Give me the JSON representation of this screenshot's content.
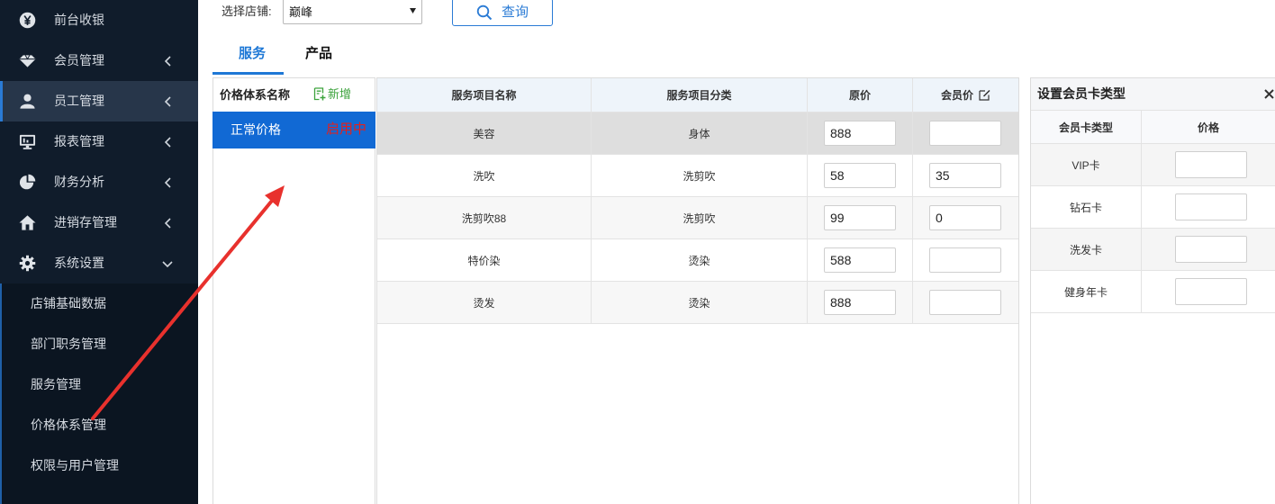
{
  "colors": {
    "accent": "#1e78d6",
    "sidebar_bg": "#101c2b",
    "sidebar_active": "#27364a",
    "status_red": "#e3201c",
    "add_green": "#3da33d",
    "annotation_red": "#e8312d"
  },
  "sidebar": {
    "items": [
      {
        "label": "前台收银",
        "icon": "yen-icon"
      },
      {
        "label": "会员管理",
        "icon": "diamond-icon"
      },
      {
        "label": "员工管理",
        "icon": "user-icon"
      },
      {
        "label": "报表管理",
        "icon": "monitor-icon"
      },
      {
        "label": "财务分析",
        "icon": "pie-chart-icon"
      },
      {
        "label": "进销存管理",
        "icon": "home-icon"
      },
      {
        "label": "系统设置",
        "icon": "gear-icon"
      }
    ],
    "submenu": [
      {
        "label": "店铺基础数据"
      },
      {
        "label": "部门职务管理"
      },
      {
        "label": "服务管理"
      },
      {
        "label": "价格体系管理"
      },
      {
        "label": "权限与用户管理"
      }
    ]
  },
  "filter": {
    "store_label": "选择店铺:",
    "store_value": "巅峰",
    "query_label": "查询"
  },
  "tabs": [
    {
      "label": "服务"
    },
    {
      "label": "产品"
    }
  ],
  "price_systems": {
    "header": "价格体系名称",
    "add_label": "新增",
    "items": [
      {
        "name": "正常价格",
        "status": "启用中"
      }
    ]
  },
  "services": {
    "columns": [
      "服务项目名称",
      "服务项目分类",
      "原价",
      "会员价"
    ],
    "rows": [
      {
        "name": "美容",
        "category": "身体",
        "price": "888",
        "member_price": ""
      },
      {
        "name": "洗吹",
        "category": "洗剪吹",
        "price": "58",
        "member_price": "35"
      },
      {
        "name": "洗剪吹88",
        "category": "洗剪吹",
        "price": "99",
        "member_price": "0"
      },
      {
        "name": "特价染",
        "category": "烫染",
        "price": "588",
        "member_price": ""
      },
      {
        "name": "烫发",
        "category": "烫染",
        "price": "888",
        "member_price": ""
      }
    ]
  },
  "card_panel": {
    "title": "设置会员卡类型",
    "columns": [
      "会员卡类型",
      "价格"
    ],
    "rows": [
      {
        "type": "VIP卡",
        "price": ""
      },
      {
        "type": "钻石卡",
        "price": ""
      },
      {
        "type": "洗发卡",
        "price": ""
      },
      {
        "type": "健身年卡",
        "price": ""
      }
    ]
  }
}
